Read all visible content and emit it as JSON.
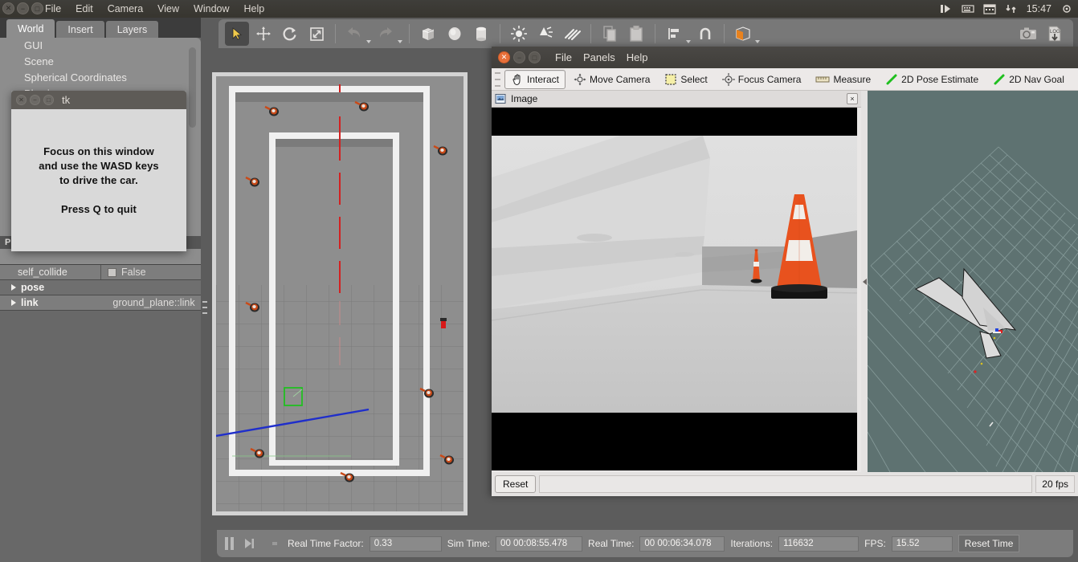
{
  "ubuntu_panel": {
    "window_buttons": [
      "close",
      "minimize",
      "maximize"
    ],
    "menu_items": [
      "File",
      "Edit",
      "Camera",
      "View",
      "Window",
      "Help"
    ],
    "tray_icons": [
      "eject-icon",
      "keyboard-icon",
      "calendar-icon",
      "network-icon"
    ],
    "clock": "15:47"
  },
  "gazebo": {
    "tabs": [
      {
        "label": "World",
        "active": true
      },
      {
        "label": "Insert",
        "active": false
      },
      {
        "label": "Layers",
        "active": false
      }
    ],
    "tree_items": [
      "GUI",
      "Scene",
      "Spherical Coordinates",
      "Physics"
    ],
    "property_header": "Property",
    "properties": [
      {
        "name": "self_collide",
        "value": "False",
        "type": "checkbox"
      },
      {
        "name": "pose",
        "value": "",
        "type": "expand"
      },
      {
        "name": "link",
        "value": "ground_plane::link",
        "type": "expand"
      }
    ],
    "toolbar": [
      {
        "name": "select-mode-icon",
        "active": true
      },
      {
        "name": "translate-mode-icon",
        "active": false
      },
      {
        "name": "rotate-mode-icon",
        "active": false
      },
      {
        "name": "scale-mode-icon",
        "active": false
      },
      {
        "name": "undo-icon",
        "active": false
      },
      {
        "name": "redo-icon",
        "active": false
      },
      {
        "name": "insert-box-icon",
        "active": false
      },
      {
        "name": "insert-sphere-icon",
        "active": false
      },
      {
        "name": "insert-cylinder-icon",
        "active": false
      },
      {
        "name": "point-light-icon",
        "active": false
      },
      {
        "name": "spot-light-icon",
        "active": false
      },
      {
        "name": "directional-light-icon",
        "active": false
      },
      {
        "name": "copy-icon",
        "active": false
      },
      {
        "name": "paste-icon",
        "active": false
      },
      {
        "name": "align-icon",
        "active": false
      },
      {
        "name": "snap-icon",
        "active": false
      },
      {
        "name": "view-mode-icon",
        "active": false
      }
    ],
    "toolbar_right": [
      "screenshot-icon",
      "log-icon"
    ],
    "statusbar": {
      "pause_label": "pause-icon",
      "step_label": "step-icon",
      "fields": [
        {
          "label": "Real Time Factor:",
          "value": "0.33"
        },
        {
          "label": "Sim Time:",
          "value": "00 00:08:55.478"
        },
        {
          "label": "Real Time:",
          "value": "00 00:06:34.078"
        },
        {
          "label": "Iterations:",
          "value": "116632"
        },
        {
          "label": "FPS:",
          "value": "15.52"
        }
      ],
      "reset_button": "Reset Time"
    }
  },
  "tk_dialog": {
    "title": "tk",
    "lines": [
      "Focus on this window",
      "and use the WASD keys",
      "to drive the car."
    ],
    "quit_line": "Press Q to quit"
  },
  "rviz": {
    "menu_items": [
      "File",
      "Panels",
      "Help"
    ],
    "tools": [
      {
        "label": "Interact",
        "icon": "hand-icon",
        "active": true
      },
      {
        "label": "Move Camera",
        "icon": "move-camera-icon",
        "active": false
      },
      {
        "label": "Select",
        "icon": "select-box-icon",
        "active": false
      },
      {
        "label": "Focus Camera",
        "icon": "focus-camera-icon",
        "active": false
      },
      {
        "label": "Measure",
        "icon": "ruler-icon",
        "active": false
      },
      {
        "label": "2D Pose Estimate",
        "icon": "pose-arrow-icon",
        "active": false
      },
      {
        "label": "2D Nav Goal",
        "icon": "nav-goal-arrow-icon",
        "active": false
      }
    ],
    "image_panel": {
      "title": "Image",
      "icon": "image-panel-icon",
      "close_label": "×"
    },
    "bottom": {
      "reset_label": "Reset",
      "status_text": "",
      "fps_label": "20 fps"
    }
  },
  "colors": {
    "gazebo_bg": "#5c5c5c",
    "gazebo_panel": "#8d8d8d",
    "rviz_bg": "#e4e2e1",
    "rviz_3d_bg": "#5e7271",
    "cone_orange": "#e8521e",
    "accent_orange": "#e8703a",
    "axis_red": "#cc2020",
    "axis_blue": "#2030cc",
    "axis_green": "#20aa40"
  }
}
